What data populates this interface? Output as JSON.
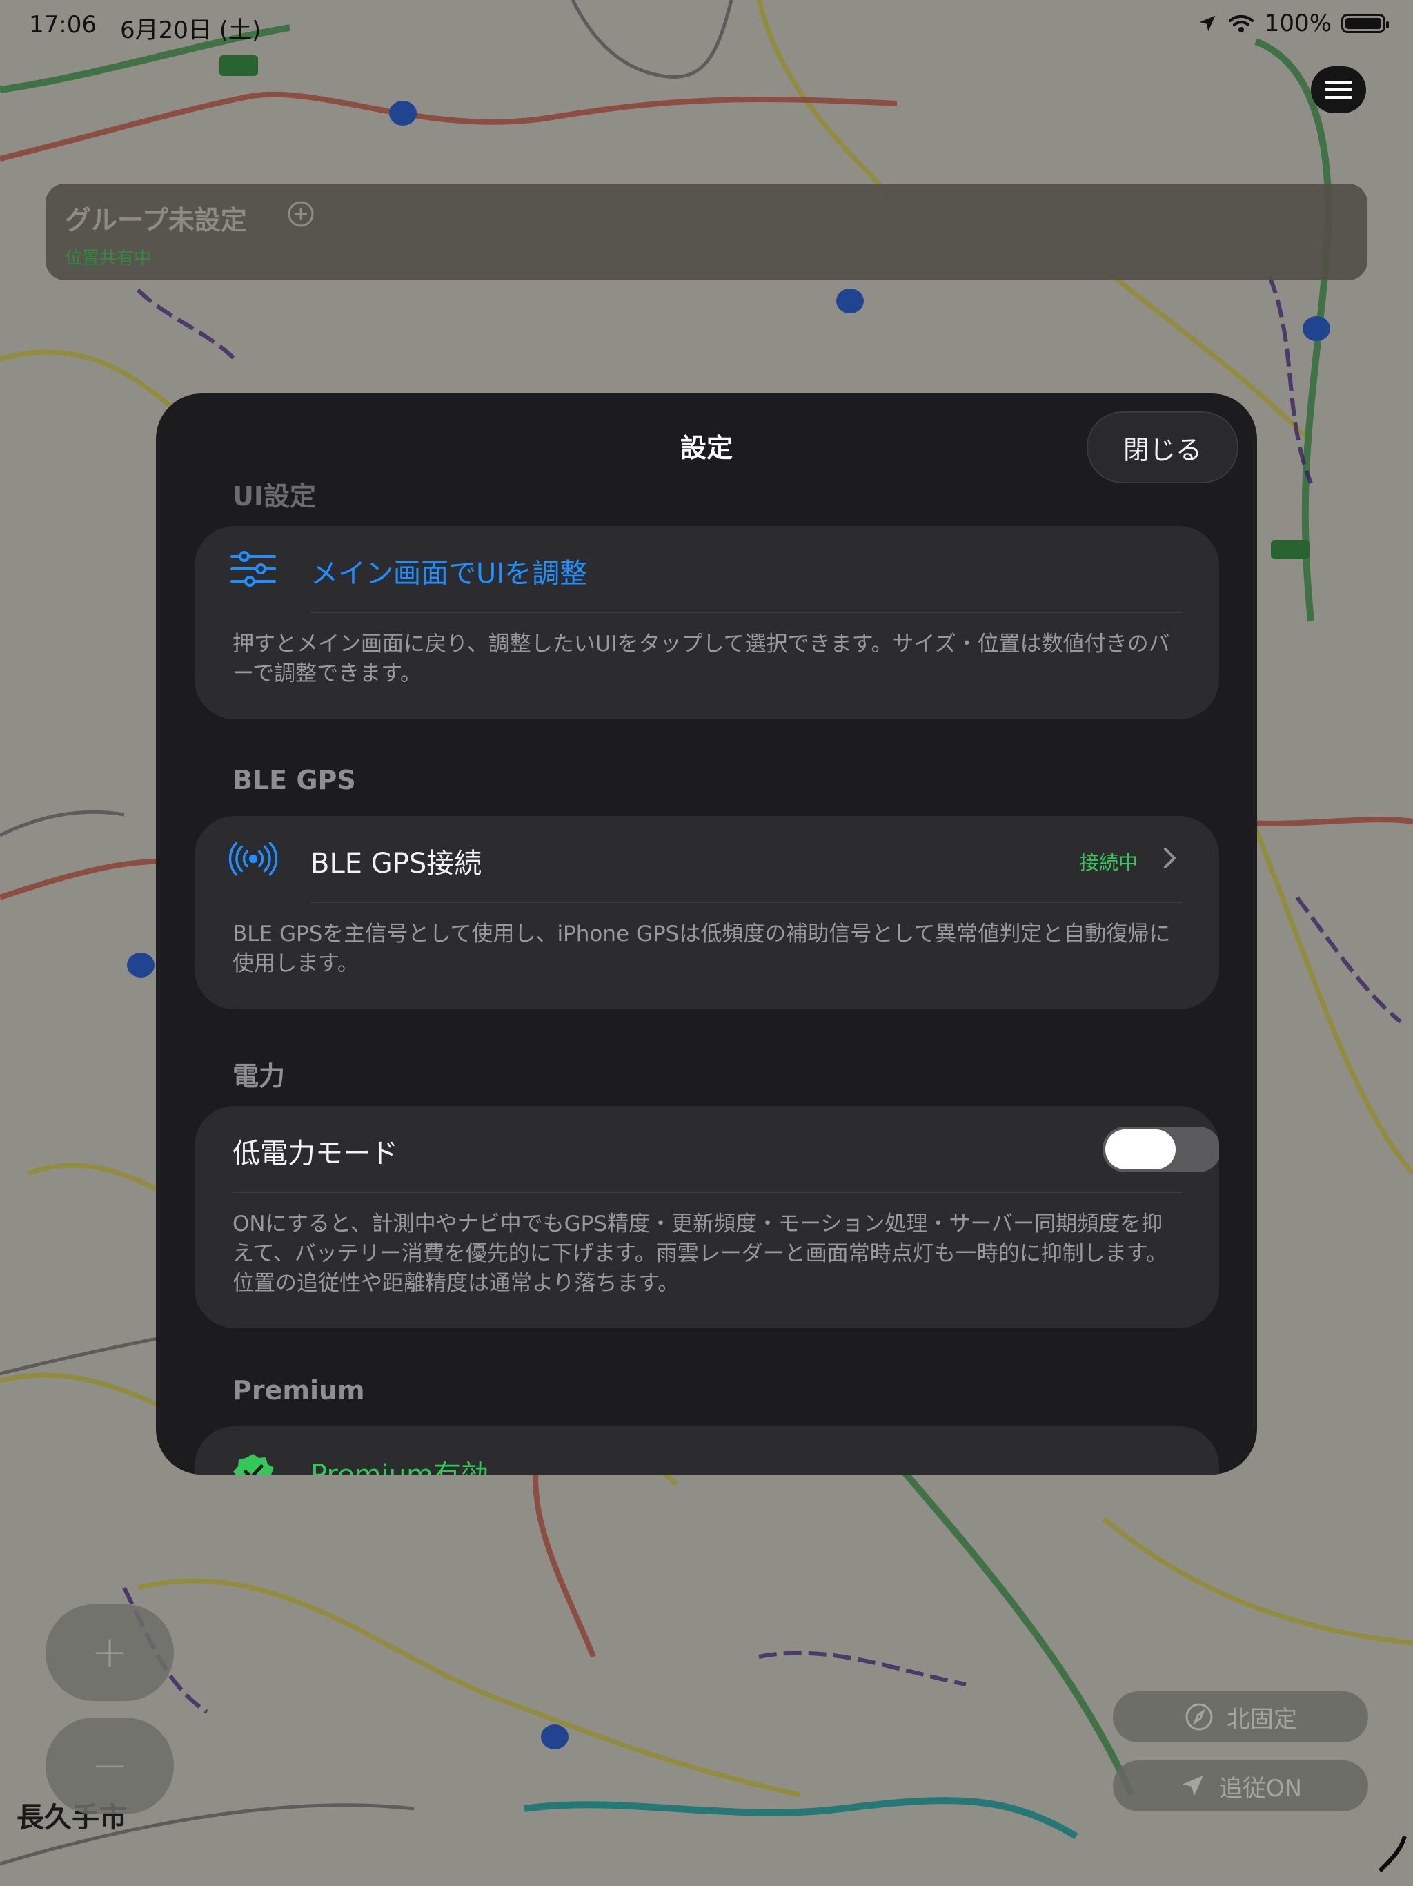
{
  "status_bar": {
    "time": "17:06",
    "date": "6月20日 (土)",
    "battery": "100%"
  },
  "group": {
    "title": "グループ未設定",
    "subtitle": "位置共有中"
  },
  "map_controls": {
    "zoom_in": "+",
    "zoom_out": "−",
    "north_lock": "北固定",
    "follow": "追従ON"
  },
  "map_labels": {
    "city": "長久手市"
  },
  "settings": {
    "title": "設定",
    "close": "閉じる",
    "ui_section": "UI設定",
    "ui_adjust_label": "メイン画面でUIを調整",
    "ui_adjust_desc": "押すとメイン画面に戻り、調整したいUIをタップして選択できます。サイズ・位置は数値付きのバーで調整できます。",
    "ble_section": "BLE GPS",
    "ble_label": "BLE GPS接続",
    "ble_status": "接続中",
    "ble_desc": "BLE GPSを主信号として使用し、iPhone GPSは低頻度の補助信号として異常値判定と自動復帰に使用します。",
    "power_section": "電力",
    "low_power_label": "低電力モード",
    "low_power_on": false,
    "low_power_desc": "ONにすると、計測中やナビ中でもGPS精度・更新頻度・モーション処理・サーバー同期頻度を抑えて、バッテリー消費を優先的に下げます。雨雲レーダーと画面常時点灯も一時的に抑制します。位置の追従性や距離精度は通常より落ちます。",
    "premium_section": "Premium",
    "premium_label": "Premium有効"
  },
  "colors": {
    "accent_blue": "#1f8fff",
    "accent_green": "#34c759",
    "sheet_bg": "#1c1c1e",
    "card_bg": "#2c2c2e"
  }
}
